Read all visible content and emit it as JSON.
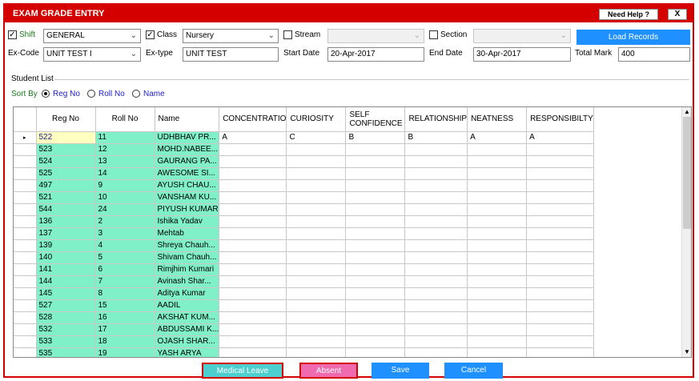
{
  "window": {
    "title": "EXAM GRADE ENTRY",
    "help_label": "Need Help ?",
    "close_label": "X"
  },
  "filters": {
    "shift": {
      "label": "Shift",
      "checked": true,
      "value": "GENERAL"
    },
    "class": {
      "label": "Class",
      "checked": true,
      "value": "Nursery"
    },
    "stream": {
      "label": "Stream",
      "checked": false,
      "value": ""
    },
    "section": {
      "label": "Section",
      "checked": false,
      "value": ""
    },
    "load_records_label": "Load Records",
    "ex_code": {
      "label": "Ex-Code",
      "value": "UNIT TEST I"
    },
    "ex_type": {
      "label": "Ex-type",
      "value": "UNIT TEST"
    },
    "start_date": {
      "label": "Start Date",
      "value": "20-Apr-2017"
    },
    "end_date": {
      "label": "End Date",
      "value": "30-Apr-2017"
    },
    "total_mark": {
      "label": "Total Mark",
      "value": "400"
    }
  },
  "student_list": {
    "label": "Student List",
    "sort_by_label": "Sort By",
    "sort_options": [
      {
        "label": "Reg No",
        "selected": true
      },
      {
        "label": "Roll No",
        "selected": false
      },
      {
        "label": "Name",
        "selected": false
      }
    ]
  },
  "grid": {
    "columns": [
      "Reg No",
      "Roll No",
      "Name",
      "CONCENTRATIO",
      "CURIOSITY",
      "SELF CONFIDENCE",
      "RELATIONSHIP",
      "NEATNESS",
      "RESPONSIBILTY"
    ],
    "current_row_marker": "▸",
    "rows": [
      [
        "522",
        "11",
        "UDHBHAV PR...",
        "A",
        "C",
        "B",
        "B",
        "A",
        "A"
      ],
      [
        "523",
        "12",
        "MOHD.NABEE...",
        "",
        "",
        "",
        "",
        "",
        ""
      ],
      [
        "524",
        "13",
        "GAURANG PA...",
        "",
        "",
        "",
        "",
        "",
        ""
      ],
      [
        "525",
        "14",
        "AWESOME SI...",
        "",
        "",
        "",
        "",
        "",
        ""
      ],
      [
        "497",
        "9",
        "AYUSH CHAU...",
        "",
        "",
        "",
        "",
        "",
        ""
      ],
      [
        "521",
        "10",
        "VANSHAM KU...",
        "",
        "",
        "",
        "",
        "",
        ""
      ],
      [
        "544",
        "24",
        "PIYUSH KUMAR",
        "",
        "",
        "",
        "",
        "",
        ""
      ],
      [
        "136",
        "2",
        "Ishika Yadav",
        "",
        "",
        "",
        "",
        "",
        ""
      ],
      [
        "137",
        "3",
        "Mehtab",
        "",
        "",
        "",
        "",
        "",
        ""
      ],
      [
        "139",
        "4",
        "Shreya Chauh...",
        "",
        "",
        "",
        "",
        "",
        ""
      ],
      [
        "140",
        "5",
        "Shivam Chauh...",
        "",
        "",
        "",
        "",
        "",
        ""
      ],
      [
        "141",
        "6",
        "Rimjhim Kumari",
        "",
        "",
        "",
        "",
        "",
        ""
      ],
      [
        "144",
        "7",
        "Avinash Shar...",
        "",
        "",
        "",
        "",
        "",
        ""
      ],
      [
        "145",
        "8",
        "Aditya Kumar",
        "",
        "",
        "",
        "",
        "",
        ""
      ],
      [
        "527",
        "15",
        "AADIL",
        "",
        "",
        "",
        "",
        "",
        ""
      ],
      [
        "528",
        "16",
        "AKSHAT KUM...",
        "",
        "",
        "",
        "",
        "",
        ""
      ],
      [
        "532",
        "17",
        "ABDUSSAMI K...",
        "",
        "",
        "",
        "",
        "",
        ""
      ],
      [
        "533",
        "18",
        "OJASH SHAR...",
        "",
        "",
        "",
        "",
        "",
        ""
      ],
      [
        "535",
        "19",
        "YASH ARYA",
        "",
        "",
        "",
        "",
        "",
        ""
      ]
    ]
  },
  "scrollbar": {
    "up_icon": "▲",
    "down_icon": "▼"
  },
  "buttons": {
    "medical_leave": "Medical Leave",
    "absent": "Absent",
    "save": "Save",
    "cancel": "Cancel"
  },
  "colors": {
    "title_bar": "#d40000",
    "primary_button": "#1e90ff",
    "green_cells": "#7ff0c8",
    "selected_cell": "#ffffc0",
    "medical_leave": "#4ecfcf",
    "absent": "#f06ab0"
  }
}
